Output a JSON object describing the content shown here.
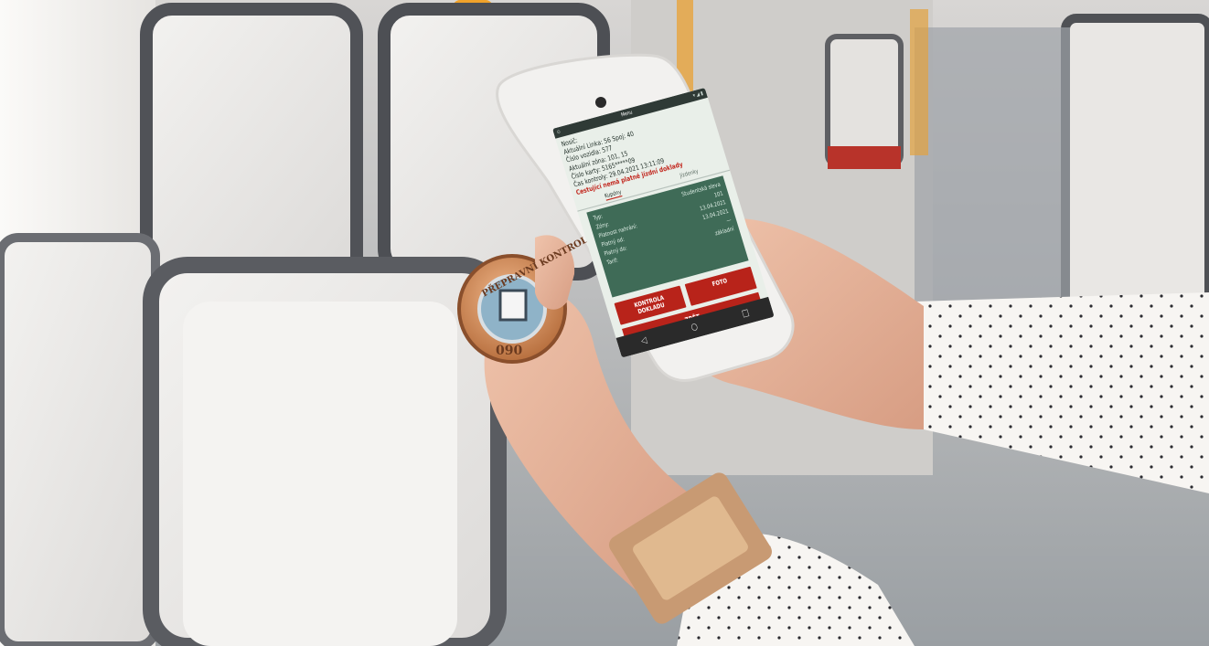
{
  "scene": {
    "description_colors": {
      "sky_window": "#f3f1ee",
      "seat_shell": "#eceae8",
      "seat_frame": "#8f8e90",
      "handrail": "#f0a22a",
      "seat_cushion_red": "#b8332a",
      "sleeve": "#f6f4f1",
      "skin": "#e6b299",
      "watch": "#c89a73",
      "device_body": "#f2f1ef"
    }
  },
  "device": {
    "status_left": "⊙",
    "status_center": "Menu",
    "status_right": "▾ ◢ ▮",
    "info_lines": [
      "Nosič:",
      "Aktuální Linka: 56 Spoj: 40",
      "Číslo vozidla: 577",
      "Aktuální zóna: 101, 15",
      "Číslo karty: 5165*****09",
      "Čas kontroly: 29.04.2021 13:11:09"
    ],
    "alert_line": "Cestující nemá platné jízdní doklady",
    "tabs": [
      "Kupóny",
      "Jízdenky"
    ],
    "panel_rows": [
      {
        "label": "Typ:",
        "value": "Studentská sleva"
      },
      {
        "label": "Zóny:",
        "value": "101"
      },
      {
        "label": "Platnost nahrání:",
        "value": "13.04.2021"
      },
      {
        "label": "Platný od:",
        "value": "13.04.2021"
      },
      {
        "label": "Platný do:",
        "value": "—"
      },
      {
        "label": "Tarif:",
        "value": "základní"
      }
    ],
    "buttons": {
      "check_label_1": "KONTROLA",
      "check_label_2": "DOKLADU",
      "photo_label": "FOTO",
      "back_label": "ZPĚT"
    },
    "nav": [
      "◁",
      "○",
      "□"
    ]
  },
  "badge": {
    "top_text": "PŘEPRAVNÍ KONTROLA",
    "number": "090"
  }
}
